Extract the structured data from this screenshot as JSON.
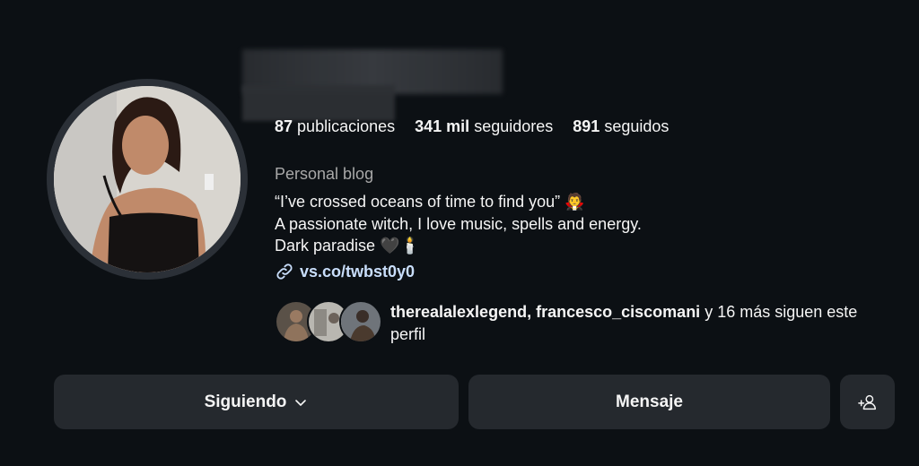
{
  "profile": {
    "stats": {
      "posts_count": "87",
      "posts_label": "publicaciones",
      "followers_count": "341 mil",
      "followers_label": "seguidores",
      "following_count": "891",
      "following_label": "seguidos"
    },
    "category": "Personal blog",
    "bio": {
      "line1": "“I’ve crossed oceans of time to find you” 🧛",
      "line2": "A passionate witch, I love music, spells and energy.",
      "line3": "Dark paradise 🖤🕯️"
    },
    "link": "vs.co/twbst0y0",
    "followed_by": {
      "user1": "therealalexlegend",
      "separator": ", ",
      "user2": "francesco_ciscomani",
      "suffix": " y 16 más siguen este perfil"
    }
  },
  "actions": {
    "following_label": "Siguiendo",
    "message_label": "Mensaje"
  },
  "icons": {
    "link": "link-icon",
    "chevron": "chevron-down-icon",
    "add_user": "add-person-icon"
  },
  "colors": {
    "background": "#0c1014",
    "button": "#25292e",
    "link": "#e0f1ff",
    "secondary_text": "#a8a8a8"
  }
}
